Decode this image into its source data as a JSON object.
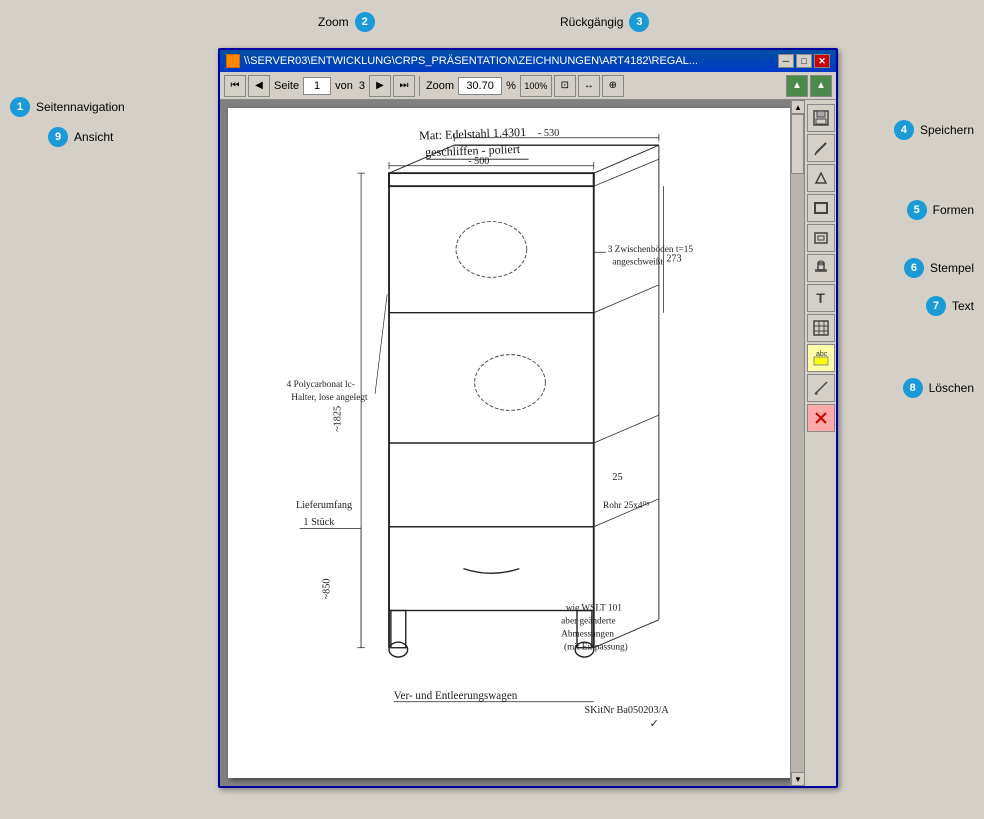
{
  "annotations": {
    "zoom_label": "Zoom",
    "zoom_badge": "2",
    "undo_label": "Rückgängig",
    "undo_badge": "3",
    "nav_label": "Seitennavigation",
    "nav_badge": "1",
    "view_label": "Ansicht",
    "view_badge": "9",
    "save_label": "Speichern",
    "save_badge": "4",
    "shapes_label": "Formen",
    "shapes_badge": "5",
    "stamp_label": "Stempel",
    "stamp_badge": "6",
    "text_label": "Text",
    "text_badge": "7",
    "delete_label": "Löschen",
    "delete_badge": "8"
  },
  "titlebar": {
    "title": "\\\\SERVER03\\ENTWICKLUNG\\CRPS_PRÄSENTATION\\ZEICHNUNGEN\\ART4182\\REGAL...",
    "min_btn": "─",
    "max_btn": "□",
    "close_btn": "✕"
  },
  "toolbar": {
    "page_label": "Seite",
    "page_current": "1",
    "page_of": "von",
    "page_total": "3",
    "zoom_label": "Zoom",
    "zoom_value": "30.70",
    "zoom_percent": "%",
    "zoom_100": "100%"
  }
}
